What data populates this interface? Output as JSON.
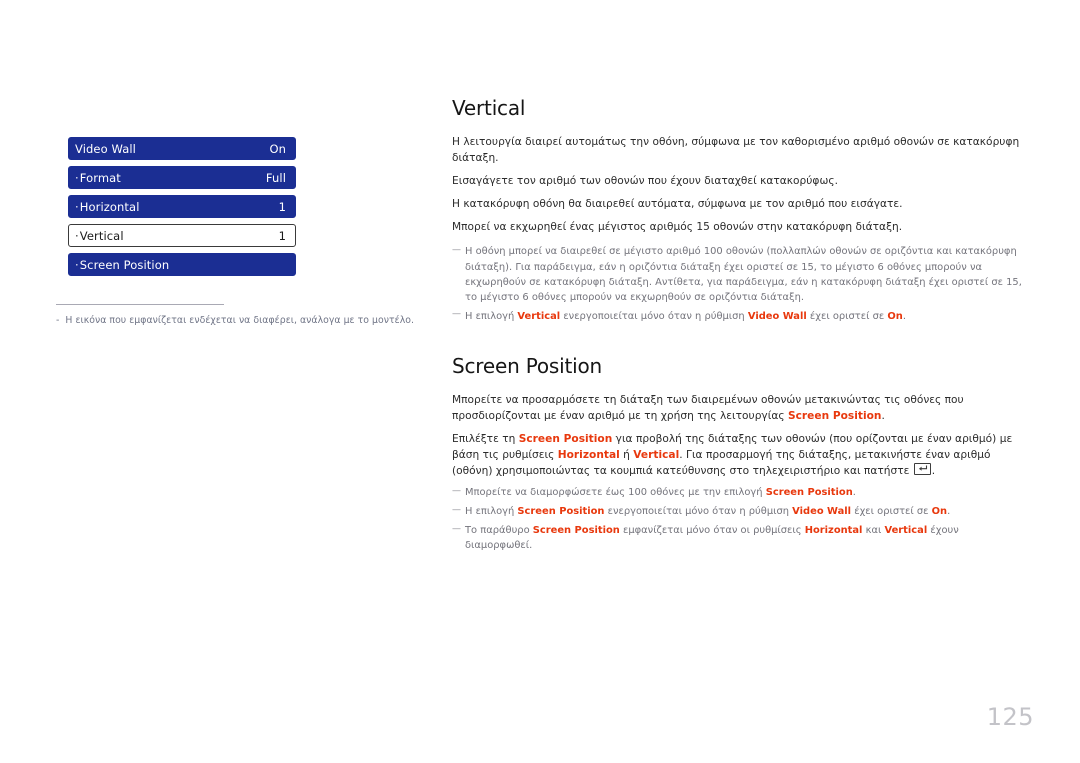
{
  "osd_menu": {
    "rows": [
      {
        "dot": "",
        "label": "Video Wall",
        "value": "On",
        "state": "normal"
      },
      {
        "dot": "·",
        "label": "Format",
        "value": "Full",
        "state": "normal"
      },
      {
        "dot": "·",
        "label": "Horizontal",
        "value": "1",
        "state": "normal"
      },
      {
        "dot": "·",
        "label": "Vertical",
        "value": "1",
        "state": "selected"
      },
      {
        "dot": "·",
        "label": "Screen Position",
        "value": "",
        "state": "normal"
      }
    ],
    "colors": {
      "bar": "#1b2e93",
      "bar_text": "#ffffff",
      "selected_bg": "#ffffff",
      "selected_text": "#1a1a1a"
    }
  },
  "caption": {
    "dash": "-",
    "text": "Η εικόνα που εμφανίζεται ενδέχεται να διαφέρει, ανάλογα με το μοντέλο."
  },
  "sections": {
    "vertical": {
      "title": "Vertical",
      "paragraphs": [
        "Η λειτουργία διαιρεί αυτομάτως την οθόνη, σύμφωνα με τον καθορισμένο αριθμό οθονών σε κατακόρυφη διάταξη.",
        "Εισαγάγετε τον αριθμό των οθονών που έχουν διαταχθεί κατακορύφως.",
        "Η κατακόρυφη οθόνη θα διαιρεθεί αυτόματα, σύμφωνα με τον αριθμό που εισάγατε.",
        "Μπορεί να εκχωρηθεί ένας μέγιστος αριθμός 15 οθονών στην κατακόρυφη διάταξη."
      ],
      "notes": [
        {
          "parts": [
            {
              "t": "Η οθόνη μπορεί να διαιρεθεί σε μέγιστο αριθμό 100 οθονών (πολλαπλών οθονών σε οριζόντια και κατακόρυφη διάταξη). Για παράδειγμα, εάν η οριζόντια διάταξη έχει οριστεί σε 15, το μέγιστο 6 οθόνες μπορούν να εκχωρηθούν σε κατακόρυφη διάταξη. Αντίθετα, για παράδειγμα, εάν η κατακόρυφη διάταξη έχει οριστεί σε 15, το μέγιστο 6 οθόνες μπορούν να εκχωρηθούν σε οριζόντια διάταξη.",
              "hl": false
            }
          ]
        },
        {
          "parts": [
            {
              "t": "Η επιλογή ",
              "hl": false
            },
            {
              "t": "Vertical",
              "hl": true
            },
            {
              "t": " ενεργοποιείται μόνο όταν η ρύθμιση ",
              "hl": false
            },
            {
              "t": "Video Wall",
              "hl": true
            },
            {
              "t": " έχει οριστεί σε ",
              "hl": false
            },
            {
              "t": "On",
              "hl": true
            },
            {
              "t": ".",
              "hl": false
            }
          ]
        }
      ]
    },
    "screen_position": {
      "title": "Screen Position",
      "paragraphs": [
        {
          "parts": [
            {
              "t": "Μπορείτε να προσαρμόσετε τη διάταξη των διαιρεμένων οθονών μετακινώντας τις οθόνες που προσδιορίζονται με έναν αριθμό με τη χρήση της λειτουργίας ",
              "hl": false
            },
            {
              "t": "Screen Position",
              "hl": true
            },
            {
              "t": ".",
              "hl": false
            }
          ]
        },
        {
          "parts": [
            {
              "t": "Επιλέξτε τη ",
              "hl": false
            },
            {
              "t": "Screen Position",
              "hl": true
            },
            {
              "t": " για προβολή της διάταξης των οθονών (που ορίζονται με έναν αριθμό) με βάση τις ρυθμίσεις ",
              "hl": false
            },
            {
              "t": "Horizontal",
              "hl": true
            },
            {
              "t": " ή ",
              "hl": false
            },
            {
              "t": "Vertical",
              "hl": true
            },
            {
              "t": ". Για προσαρμογή της διάταξης, μετακινήστε έναν αριθμό (οθόνη) χρησιμοποιώντας τα κουμπιά κατεύθυνσης στο τηλεχειριστήριο και πατήστε ",
              "hl": false
            },
            {
              "t": "[ENTER-KEY-ICON]",
              "icon": "enter-key-icon"
            },
            {
              "t": ".",
              "hl": false
            }
          ]
        }
      ],
      "notes": [
        {
          "parts": [
            {
              "t": "Μπορείτε να διαμορφώσετε έως 100 οθόνες με την επιλογή ",
              "hl": false
            },
            {
              "t": "Screen Position",
              "hl": true
            },
            {
              "t": ".",
              "hl": false
            }
          ]
        },
        {
          "parts": [
            {
              "t": "Η επιλογή ",
              "hl": false
            },
            {
              "t": "Screen Position",
              "hl": true
            },
            {
              "t": " ενεργοποιείται μόνο όταν η ρύθμιση ",
              "hl": false
            },
            {
              "t": "Video Wall",
              "hl": true
            },
            {
              "t": " έχει οριστεί σε ",
              "hl": false
            },
            {
              "t": "On",
              "hl": true
            },
            {
              "t": ".",
              "hl": false
            }
          ]
        },
        {
          "parts": [
            {
              "t": "Το παράθυρο ",
              "hl": false
            },
            {
              "t": "Screen Position",
              "hl": true
            },
            {
              "t": " εμφανίζεται μόνο όταν οι ρυθμίσεις ",
              "hl": false
            },
            {
              "t": "Horizontal",
              "hl": true
            },
            {
              "t": " και ",
              "hl": false
            },
            {
              "t": "Vertical",
              "hl": true
            },
            {
              "t": " έχουν διαμορφωθεί.",
              "hl": false
            }
          ]
        }
      ]
    }
  },
  "page_number": "125",
  "colors": {
    "highlight": "#e8380d",
    "body_text": "#2b2b2b",
    "note_text": "#73737b",
    "page_number": "#c3c3c8"
  }
}
